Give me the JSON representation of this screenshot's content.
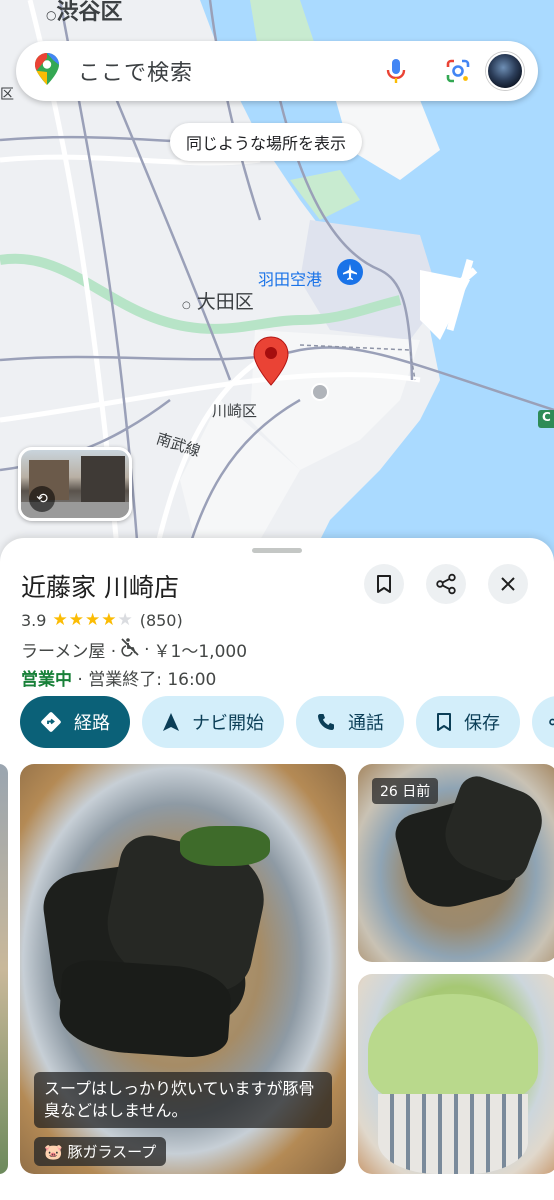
{
  "map": {
    "labels": {
      "shibuya": "渋谷区",
      "ota": "大田区",
      "kawasaki": "川崎区",
      "nambu_line": "南武線",
      "haneda": "羽田空港",
      "edge_char": "区",
      "route_badge": "C"
    },
    "colors": {
      "water": "#aadaff",
      "land": "#eef0f3",
      "road": "#ffffff",
      "green": "#c8ebd0",
      "pin": "#ea4335",
      "airport": "#1a73e8"
    }
  },
  "search": {
    "placeholder": "ここで検索"
  },
  "chip_similar": {
    "label": "同じような場所を表示"
  },
  "place": {
    "name": "近藤家 川崎店",
    "rating": "3.9",
    "rating_value": 3.9,
    "reviews": "(850)",
    "category": "ラーメン屋 ·",
    "accessibility_sep": "·",
    "price": "￥1～1,000",
    "open_status": "営業中",
    "closing": " · 営業終了: 16:00"
  },
  "actions": [
    {
      "label": "経路",
      "icon": "directions-icon"
    },
    {
      "label": "ナビ開始",
      "icon": "navigation-icon"
    },
    {
      "label": "通話",
      "icon": "phone-icon"
    },
    {
      "label": "保存",
      "icon": "bookmark-icon"
    }
  ],
  "photos": {
    "main_caption": "スープはしっかり炊いていますが豚骨臭などはしません。",
    "main_tag": "🐷 豚ガラスープ",
    "top_right_badge": "26 日前"
  }
}
